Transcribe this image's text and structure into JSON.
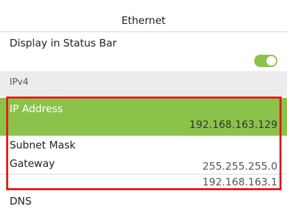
{
  "header": {
    "title": "Ethernet"
  },
  "display_status_bar": {
    "label": "Display in Status Bar",
    "enabled": true
  },
  "section_ipv4": {
    "label": "IPv4"
  },
  "ip_address": {
    "label": "IP Address",
    "value": "192.168.163.129"
  },
  "subnet_mask": {
    "label": "Subnet Mask",
    "value": "255.255.255.0"
  },
  "gateway": {
    "label": "Gateway",
    "value": "192.168.163.1"
  },
  "dns": {
    "label": "DNS"
  },
  "colors": {
    "accent": "#8bc34a",
    "highlight_border": "#e31b1b",
    "section_bg": "#ececec"
  }
}
